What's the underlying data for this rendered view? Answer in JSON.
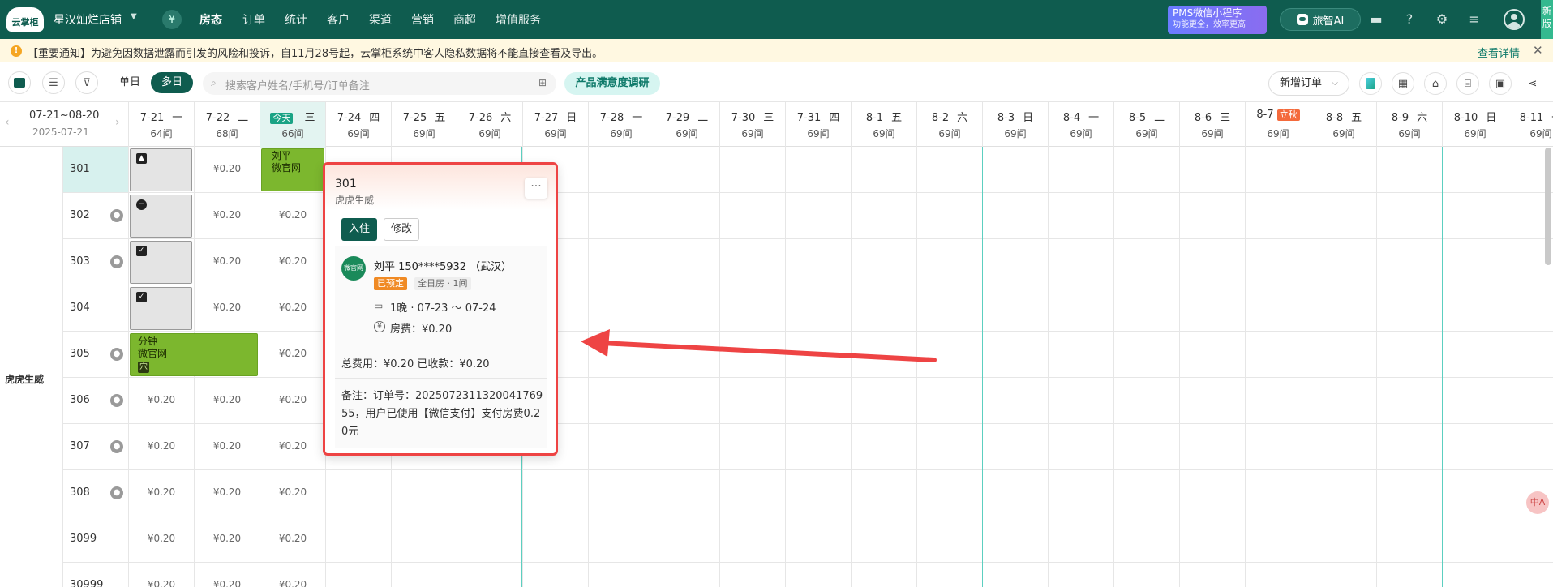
{
  "nav": {
    "logo": "云掌柜",
    "store": "星汉灿烂店铺",
    "items": [
      "房态",
      "订单",
      "统计",
      "客户",
      "渠道",
      "营销",
      "商超",
      "增值服务"
    ],
    "pms_title": "PMS微信小程序",
    "pms_sub": "功能更全，效率更高",
    "ai_label": "旅智AI",
    "new_label": "新版"
  },
  "notice": {
    "text": "【重要通知】为避免因数据泄露而引发的风险和投诉，自11月28号起，云掌柜系统中客人隐私数据将不能直接查看及导出。",
    "link": "查看详情"
  },
  "toolbar": {
    "single": "单日",
    "multi": "多日",
    "search_placeholder": "搜索客户姓名/手机号/订单备注",
    "survey": "产品满意度调研",
    "new_order": "新增订单"
  },
  "range": {
    "main": "07-21~08-20",
    "sub": "2025-07-21"
  },
  "columns": [
    {
      "date": "7-21",
      "wd": "一",
      "cnt": "64间"
    },
    {
      "date": "7-22",
      "wd": "二",
      "cnt": "68间"
    },
    {
      "date": "今天",
      "wd": "三",
      "cnt": "66间",
      "today": true
    },
    {
      "date": "7-24",
      "wd": "四",
      "cnt": "69间"
    },
    {
      "date": "7-25",
      "wd": "五",
      "cnt": "69间"
    },
    {
      "date": "7-26",
      "wd": "六",
      "cnt": "69间"
    },
    {
      "date": "7-27",
      "wd": "日",
      "cnt": "69间"
    },
    {
      "date": "7-28",
      "wd": "一",
      "cnt": "69间"
    },
    {
      "date": "7-29",
      "wd": "二",
      "cnt": "69间"
    },
    {
      "date": "7-30",
      "wd": "三",
      "cnt": "69间"
    },
    {
      "date": "7-31",
      "wd": "四",
      "cnt": "69间"
    },
    {
      "date": "8-1",
      "wd": "五",
      "cnt": "69间"
    },
    {
      "date": "8-2",
      "wd": "六",
      "cnt": "69间"
    },
    {
      "date": "8-3",
      "wd": "日",
      "cnt": "69间"
    },
    {
      "date": "8-4",
      "wd": "一",
      "cnt": "69间"
    },
    {
      "date": "8-5",
      "wd": "二",
      "cnt": "69间"
    },
    {
      "date": "8-6",
      "wd": "三",
      "cnt": "69间"
    },
    {
      "date": "8-7",
      "wd": "立秋",
      "cnt": "69间",
      "festival": true
    },
    {
      "date": "8-8",
      "wd": "五",
      "cnt": "69间"
    },
    {
      "date": "8-9",
      "wd": "六",
      "cnt": "69间"
    },
    {
      "date": "8-10",
      "wd": "日",
      "cnt": "69间"
    },
    {
      "date": "8-11",
      "wd": "一",
      "cnt": "69间"
    }
  ],
  "group": "虎虎生威",
  "rooms": [
    {
      "num": "301",
      "person": false
    },
    {
      "num": "302",
      "person": true
    },
    {
      "num": "303",
      "person": true
    },
    {
      "num": "304",
      "person": false
    },
    {
      "num": "305",
      "person": true
    },
    {
      "num": "306",
      "person": true
    },
    {
      "num": "307",
      "person": true
    },
    {
      "num": "308",
      "person": true
    },
    {
      "num": "3099",
      "person": false
    },
    {
      "num": "30999",
      "person": false
    }
  ],
  "price": "¥0.20",
  "blocks": {
    "b301_name": "刘平",
    "b301_src": "微官网",
    "b305_l1": "分钟",
    "b305_l2": "微官网",
    "b305_tag": "穴"
  },
  "popup": {
    "room": "301",
    "group": "虎虎生威",
    "more": "···",
    "checkin": "入住",
    "edit": "修改",
    "wx_logo": "微官网",
    "guest": "刘平 150****5932 （武汉）",
    "status": "已预定",
    "type": "全日房 · 1间",
    "stay": "1晚 · 07-23 ～ 07-24",
    "fee": "房费：¥0.20",
    "totals": "总费用：¥0.20   已收款：¥0.20",
    "remark": "备注：订单号：202507231132004176955，用户已使用【微信支付】支付房费0.20元"
  },
  "float_btn": "中A"
}
